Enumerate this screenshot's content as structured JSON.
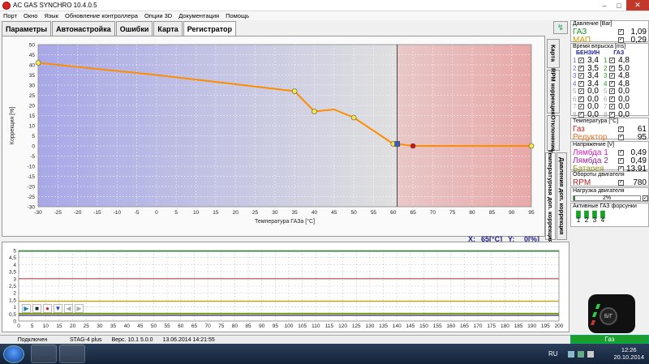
{
  "window": {
    "title": "AC GAS SYNCHRO  10.4.0.5"
  },
  "menu": [
    "Порт",
    "Окно",
    "Язык",
    "Обновление контроллера",
    "Опции 3D",
    "Документация",
    "Помощь"
  ],
  "tabs": [
    "Параметры",
    "Автонастройка",
    "Ошибки",
    "Карта",
    "Регистратор"
  ],
  "active_tab": 4,
  "vertical_tabs": [
    "Карта",
    "RPM коррекция",
    "Отклонение",
    "Температурная доп. коррекция",
    "Давления доп. коррекция"
  ],
  "xy_readout": {
    "x_label": "X:",
    "x_value": "65[°C]",
    "y_label": "Y:",
    "y_value": "0[%]"
  },
  "chart_data": [
    {
      "type": "line",
      "xlabel": "Температура ГАЗа [°C]",
      "ylabel": "Коррекция [%]",
      "xlim": [
        -30,
        95
      ],
      "ylim": [
        -30,
        50
      ],
      "x_ticks": [
        "-30",
        "-25",
        "-20",
        "-15",
        "-10",
        "-5",
        "0",
        "5",
        "10",
        "15",
        "20",
        "25",
        "30",
        "35",
        "40",
        "45",
        "50",
        "55",
        "60",
        "65",
        "70",
        "75",
        "80",
        "85",
        "90",
        "95"
      ],
      "y_ticks": [
        "50",
        "45",
        "40",
        "35",
        "30",
        "25",
        "20",
        "15",
        "10",
        "5",
        "0",
        "-5",
        "-10",
        "-15",
        "-20",
        "-25",
        "-30"
      ],
      "series": [
        {
          "color": "#ff8c00",
          "x": [
            -30,
            0,
            35,
            40,
            45,
            50,
            60,
            61,
            65,
            95
          ],
          "y": [
            41,
            35,
            27,
            17,
            18,
            14,
            1,
            1,
            0,
            0
          ]
        }
      ],
      "markers": [
        {
          "x": -30,
          "y": 41,
          "kind": "yellow"
        },
        {
          "x": 35,
          "y": 27,
          "kind": "yellow"
        },
        {
          "x": 40,
          "y": 17,
          "kind": "yellow"
        },
        {
          "x": 50,
          "y": 14,
          "kind": "yellow"
        },
        {
          "x": 60,
          "y": 1,
          "kind": "yellow"
        },
        {
          "x": 61,
          "y": 1,
          "kind": "blue"
        },
        {
          "x": 65,
          "y": 0,
          "kind": "red"
        },
        {
          "x": 95,
          "y": 0,
          "kind": "yellow"
        }
      ],
      "cursor_x": 61,
      "background": {
        "left_color": "#a8a8e8",
        "right_color": "#e8a8a8",
        "split_x": 61
      },
      "grid": true
    },
    {
      "type": "line",
      "xlim": [
        0,
        200
      ],
      "ylim": [
        0,
        5
      ],
      "x_ticks": [
        "0",
        "5",
        "10",
        "15",
        "20",
        "25",
        "30",
        "35",
        "40",
        "45",
        "50",
        "55",
        "60",
        "65",
        "70",
        "75",
        "80",
        "85",
        "90",
        "95",
        "100",
        "105",
        "110",
        "115",
        "120",
        "125",
        "130",
        "135",
        "140",
        "145",
        "150",
        "155",
        "160",
        "165",
        "170",
        "175",
        "180",
        "185",
        "190",
        "195",
        "200"
      ],
      "y_ticks": [
        "5",
        "4,5",
        "4",
        "3,5",
        "3",
        "2,5",
        "2",
        "1,5",
        "1",
        "0,5",
        "0"
      ],
      "series": [
        {
          "color": "#c84040",
          "y_const": 3.0
        },
        {
          "color": "#2a8a2a",
          "y_const": 4.95
        },
        {
          "color": "#2020a0",
          "y_const": 0.4
        },
        {
          "color": "#d4b000",
          "y_const": 0.48
        },
        {
          "color": "#c8a000",
          "y_const": 1.4
        },
        {
          "color": "#40a040",
          "y_const": 0.55
        }
      ]
    }
  ],
  "right_panel": {
    "pressure": {
      "header": "Давление [Bar]",
      "gas_label": "ГАЗ",
      "gas_value": "1,09",
      "map_label": "МАП",
      "map_value": "0,29"
    },
    "injection": {
      "header": "Время впрыска [ms]",
      "col1": "БЕНЗИН",
      "col2": "ГАЗ",
      "rows": [
        {
          "n": "1",
          "petrol": "3,4",
          "gas": "4,8"
        },
        {
          "n": "2",
          "petrol": "3,5",
          "gas": "5,0"
        },
        {
          "n": "3",
          "petrol": "3,4",
          "gas": "4,8"
        },
        {
          "n": "4",
          "petrol": "3,4",
          "gas": "4,8"
        },
        {
          "n": "5",
          "petrol": "0,0",
          "gas": "0,0"
        },
        {
          "n": "6",
          "petrol": "0,0",
          "gas": "0,0"
        },
        {
          "n": "7",
          "petrol": "0,0",
          "gas": "0,0"
        },
        {
          "n": "8",
          "petrol": "0,0",
          "gas": "0,0"
        }
      ]
    },
    "temperature": {
      "header": "Температура [°C]",
      "gas_label": "Газ",
      "gas_value": "61",
      "reducer_label": "Редуктор",
      "reducer_value": "95"
    },
    "voltage": {
      "header": "Напряжение [V]",
      "l1_label": "Лямбда 1",
      "l1_value": "0,49",
      "l2_label": "Лямбда 2",
      "l2_value": "0,49",
      "bat_label": "Батарея",
      "bat_value": "13,91"
    },
    "rpm": {
      "header": "Обороты двигателя",
      "label": "RPM",
      "value": "780"
    },
    "load": {
      "header": "Нагрузка двигателя",
      "value": "2%",
      "fraction": 0.02
    },
    "injectors": {
      "header": "Активные ГАЗ форсунки",
      "labels": [
        "1",
        "2",
        "3",
        "4"
      ]
    }
  },
  "status_bar": {
    "connection": "Подключен",
    "device": "STAG-4 plus",
    "version": "Верс. 10.1  5.0.0",
    "date": "13.06.2014 14:21:55",
    "fuel": "Газ"
  },
  "taskbar": {
    "lang": "RU",
    "time": "12:26",
    "date": "20.10.2014"
  },
  "colors": {
    "gas": "#1a9e2c",
    "petrol_num": "#6a6ad0",
    "gas_num": "#20a020",
    "orange_line": "#ff8c00"
  }
}
